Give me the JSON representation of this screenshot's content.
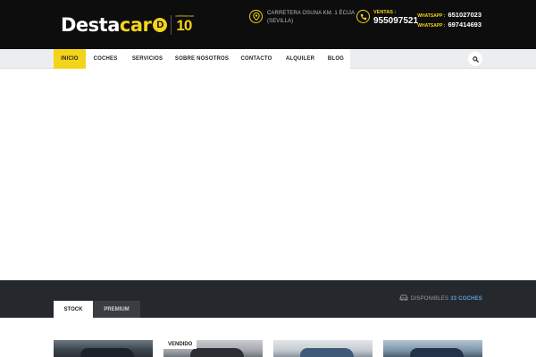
{
  "header": {
    "logo_main": "Desta",
    "logo_accent": "car",
    "logo_badge": "D",
    "anniversary_small": "celebramos",
    "anniversary_number": "10",
    "address_line1": "CARRETERA OSUNA KM. 1 ÉCIJA",
    "address_line2": "(SEVILLA)",
    "sales_label": "VENTAS :",
    "sales_phone": "955097521",
    "whatsapp": [
      {
        "label": "WHATSAPP :",
        "number": "651027023"
      },
      {
        "label": "WHATSAPP :",
        "number": "697414693"
      }
    ]
  },
  "nav": {
    "items": [
      {
        "label": "INICIO",
        "active": true
      },
      {
        "label": "COCHES",
        "active": false
      },
      {
        "label": "SERVICIOS",
        "active": false
      },
      {
        "label": "SOBRE NOSOTROS",
        "active": false
      },
      {
        "label": "CONTACTO",
        "active": false
      },
      {
        "label": "ALQUILER",
        "active": false
      },
      {
        "label": "BLOG",
        "active": false
      }
    ],
    "search_icon": "search-icon"
  },
  "stock": {
    "tabs": [
      {
        "label": "STOCK",
        "active": true
      },
      {
        "label": "PREMIUM",
        "active": false
      }
    ],
    "available_label": "DISPONIBLES",
    "available_count": "33 COCHES"
  },
  "cars": [
    {
      "badge": ""
    },
    {
      "badge": "VENDIDO"
    },
    {
      "badge": ""
    },
    {
      "badge": ""
    }
  ],
  "colors": {
    "brand_yellow": "#f4d31b",
    "header_bg": "#0d0d0d",
    "band_bg": "#25292d",
    "accent_blue": "#5c9fe3"
  }
}
